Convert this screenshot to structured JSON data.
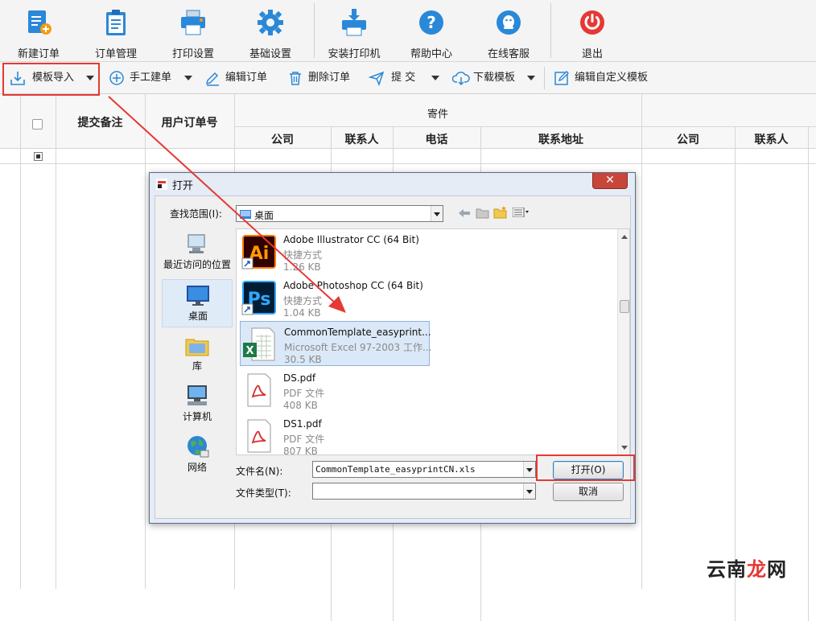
{
  "toolbar_top": {
    "items": [
      {
        "label": "新建订单",
        "icon": "new-order-icon"
      },
      {
        "label": "订单管理",
        "icon": "clipboard-icon"
      },
      {
        "label": "打印设置",
        "icon": "printer-settings-icon"
      },
      {
        "label": "基础设置",
        "icon": "gear-icon"
      },
      {
        "label": "安装打印机",
        "icon": "install-printer-icon"
      },
      {
        "label": "帮助中心",
        "icon": "help-icon"
      },
      {
        "label": "在线客服",
        "icon": "support-chat-icon"
      },
      {
        "label": "退出",
        "icon": "power-icon"
      }
    ]
  },
  "toolbar_second": {
    "template_import": "模板导入",
    "manual_create": "手工建单",
    "edit_order": "编辑订单",
    "delete_order": "删除订单",
    "submit": "提 交",
    "download_template": "下载模板",
    "edit_custom_template": "编辑自定义模板"
  },
  "table": {
    "headers": {
      "submit_note": "提交备注",
      "user_order_no": "用户订单号",
      "sender_group": "寄件",
      "company": "公司",
      "contact": "联系人",
      "phone": "电话",
      "address": "联系地址",
      "company2": "公司",
      "contact2": "联系人"
    }
  },
  "dialog": {
    "title": "打开",
    "lookin_label": "查找范围(I):",
    "lookin_value": "桌面",
    "places": [
      {
        "label": "最近访问的位置",
        "icon": "recent-places-icon"
      },
      {
        "label": "桌面",
        "icon": "desktop-icon"
      },
      {
        "label": "库",
        "icon": "library-icon"
      },
      {
        "label": "计算机",
        "icon": "computer-icon"
      },
      {
        "label": "网络",
        "icon": "network-icon"
      }
    ],
    "files": [
      {
        "name": "Adobe Illustrator CC (64 Bit)",
        "type": "快捷方式",
        "size": "1.26 KB",
        "icon": "illustrator-icon"
      },
      {
        "name": "Adobe Photoshop CC (64 Bit)",
        "type": "快捷方式",
        "size": "1.04 KB",
        "icon": "photoshop-icon"
      },
      {
        "name": "CommonTemplate_easyprint...",
        "type": "Microsoft Excel 97-2003 工作...",
        "size": "30.5 KB",
        "icon": "excel-file-icon"
      },
      {
        "name": "DS.pdf",
        "type": "PDF 文件",
        "size": "408 KB",
        "icon": "pdf-file-icon"
      },
      {
        "name": "DS1.pdf",
        "type": "PDF 文件",
        "size": "807 KB",
        "icon": "pdf-file-icon"
      }
    ],
    "filename_label": "文件名(N):",
    "filename_value": "CommonTemplate_easyprintCN.xls",
    "filetype_label": "文件类型(T):",
    "filetype_value": "",
    "open_button": "打开(O)",
    "cancel_button": "取消",
    "close_glyph": "✕"
  },
  "watermark": {
    "part1": "云南",
    "part2": "龙",
    "part3": "网"
  },
  "colors": {
    "highlight_red": "#e53935",
    "brand_blue": "#2a88d8"
  }
}
